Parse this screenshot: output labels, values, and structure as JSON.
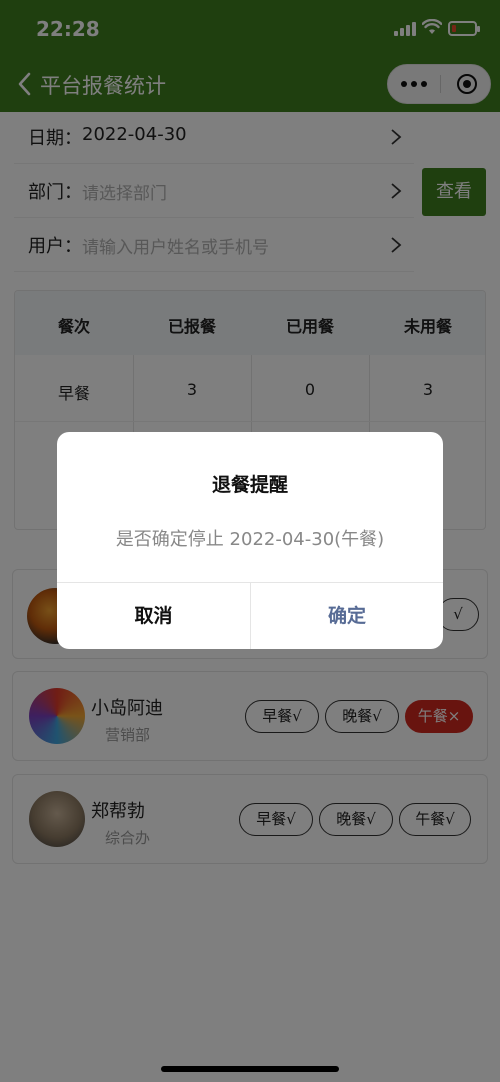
{
  "status_bar": {
    "time": "22:28"
  },
  "header": {
    "title": "平台报餐统计"
  },
  "form": {
    "date": {
      "label": "日期：",
      "value": "2022-04-30"
    },
    "dept": {
      "label": "部门：",
      "placeholder": "请选择部门"
    },
    "user": {
      "label": "用户：",
      "placeholder": "请输入用户姓名或手机号"
    },
    "query_button": "查看"
  },
  "stats": {
    "headers": [
      "餐次",
      "已报餐",
      "已用餐",
      "未用餐"
    ],
    "rows": [
      [
        "早餐",
        "3",
        "0",
        "3"
      ]
    ]
  },
  "users": [
    {
      "name": "小岛阿迪",
      "dept": "营销部",
      "tags": [
        {
          "label": "早餐√",
          "off": false
        },
        {
          "label": "晚餐√",
          "off": false
        },
        {
          "label": "午餐×",
          "off": true
        }
      ]
    },
    {
      "name": "郑帮勃",
      "dept": "综合办",
      "tags": [
        {
          "label": "早餐√",
          "off": false
        },
        {
          "label": "晚餐√",
          "off": false
        },
        {
          "label": "午餐√",
          "off": false
        }
      ]
    }
  ],
  "partial_card_tag": "√",
  "dialog": {
    "title": "退餐提醒",
    "message": "是否确定停止 2022-04-30(午餐)",
    "cancel": "取消",
    "confirm": "确定"
  },
  "colors": {
    "brand_green": "#3e7e1f",
    "cancel_red": "#d1281f",
    "confirm_link": "#576b95"
  }
}
